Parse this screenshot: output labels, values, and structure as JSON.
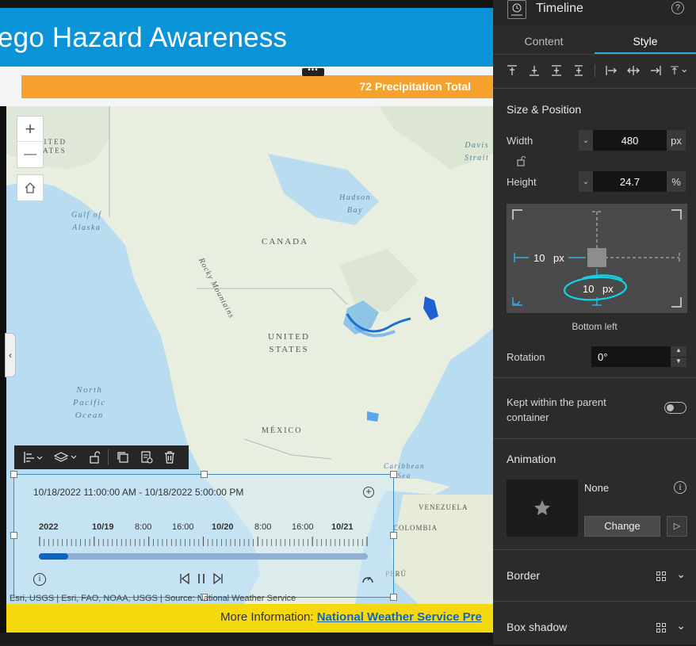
{
  "app": {
    "header_title": "ego Hazard Awareness",
    "orange_banner": "72 Precipitation Total"
  },
  "map": {
    "labels": {
      "canada": "CANADA",
      "us_line1": "UNITED",
      "us_line2": "STATES",
      "mexico": "MÉXICO",
      "venezuela": "VENEZUELA",
      "colombia": "COLOMBIA",
      "peru": "PERÚ",
      "us_partial_1": "NITED",
      "us_partial_2": "TATES",
      "rocky": "Rocky Mountains",
      "hudson_1": "Hudson",
      "hudson_2": "Bay",
      "davis_1": "Davis",
      "davis_2": "Strait",
      "alaska_1": "Gulf of",
      "alaska_2": "Alaska",
      "pacific_1": "North",
      "pacific_2": "Pacific",
      "pacific_3": "Ocean",
      "caribbean_1": "Caribbean",
      "caribbean_2": "Sea"
    },
    "zoom_in": "+",
    "zoom_out": "—",
    "attribution": "Esri, USGS | Esri, FAO, NOAA, USGS | Source: National Weather Service"
  },
  "timeline": {
    "range": "10/18/2022 11:00:00 AM - 10/18/2022 5:00:00 PM",
    "ticks": [
      {
        "label": "2022",
        "bold": true
      },
      {
        "label": "10/19",
        "bold": true
      },
      {
        "label": "8:00",
        "bold": false
      },
      {
        "label": "16:00",
        "bold": false
      },
      {
        "label": "10/20",
        "bold": true
      },
      {
        "label": "8:00",
        "bold": false
      },
      {
        "label": "16:00",
        "bold": false
      },
      {
        "label": "10/21",
        "bold": true
      }
    ],
    "progress": 0.09
  },
  "footer": {
    "prefix": "More Information: ",
    "link": "National Weather Service Pre"
  },
  "panel": {
    "title": "Timeline",
    "tabs": [
      "Content",
      "Style"
    ],
    "size_position": "Size & Position",
    "width_label": "Width",
    "width_value": "480",
    "width_unit": "px",
    "height_label": "Height",
    "height_value": "24.7",
    "height_unit": "%",
    "left_offset": "10",
    "left_unit": "px",
    "bottom_offset": "10",
    "bottom_unit": "px",
    "anchor": "Bottom left",
    "rotation_label": "Rotation",
    "rotation_value": "0°",
    "kept_within_1": "Kept within the parent",
    "kept_within_2": "container",
    "animation_title": "Animation",
    "animation_value": "None",
    "change_button": "Change",
    "border": "Border",
    "box_shadow": "Box shadow"
  },
  "colors": {
    "header_blue": "#0b93d8",
    "banner_orange": "#f6a12e",
    "footer_yellow": "#f5d80e",
    "accent_teal": "#32a9df",
    "highlight_cyan": "#12d2e6"
  }
}
